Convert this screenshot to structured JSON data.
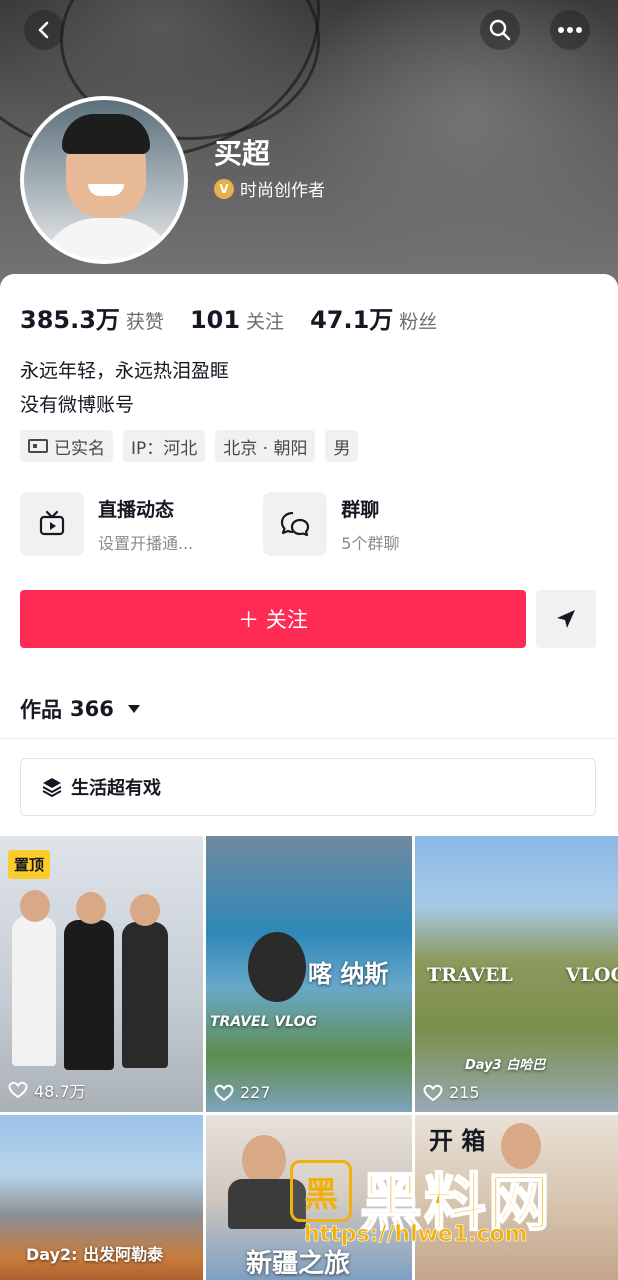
{
  "profile": {
    "name": "买超",
    "creator_label": "时尚创作者",
    "badge": "V"
  },
  "stats": [
    {
      "value": "385.3万",
      "label": "获赞"
    },
    {
      "value": "101",
      "label": "关注"
    },
    {
      "value": "47.1万",
      "label": "粉丝"
    }
  ],
  "bio": {
    "line1": "永远年轻，永远热泪盈眶",
    "line2": "没有微博账号"
  },
  "tags": [
    "已实名",
    "IP：河北",
    "北京 · 朝阳",
    "男"
  ],
  "features": [
    {
      "title": "直播动态",
      "subtitle": "设置开播通..."
    },
    {
      "title": "群聊",
      "subtitle": "5个群聊"
    }
  ],
  "actions": {
    "follow_label": "＋ 关注"
  },
  "works": {
    "label": "作品",
    "count": "366"
  },
  "collection": {
    "label": "生活超有戏"
  },
  "videos": [
    {
      "pinned": "置顶",
      "likes": "48.7万"
    },
    {
      "likes": "227",
      "caption": "喀  纳斯",
      "sub_caption": "TRAVEL VLOG"
    },
    {
      "likes": "215",
      "caption": "TRAVEL        VLOG",
      "sub_caption": "Day3  白哈巴"
    },
    {
      "caption": "Day2: 出发阿勒泰"
    },
    {
      "caption": "新疆之旅"
    },
    {
      "caption": "开  箱"
    }
  ],
  "watermark": {
    "logo": "黑",
    "text": "黑料网",
    "url": "https://hlwe1.com"
  },
  "colors": {
    "accent": "#fe2c55",
    "pinned": "#facc2c",
    "watermark": "#f1b00c"
  }
}
